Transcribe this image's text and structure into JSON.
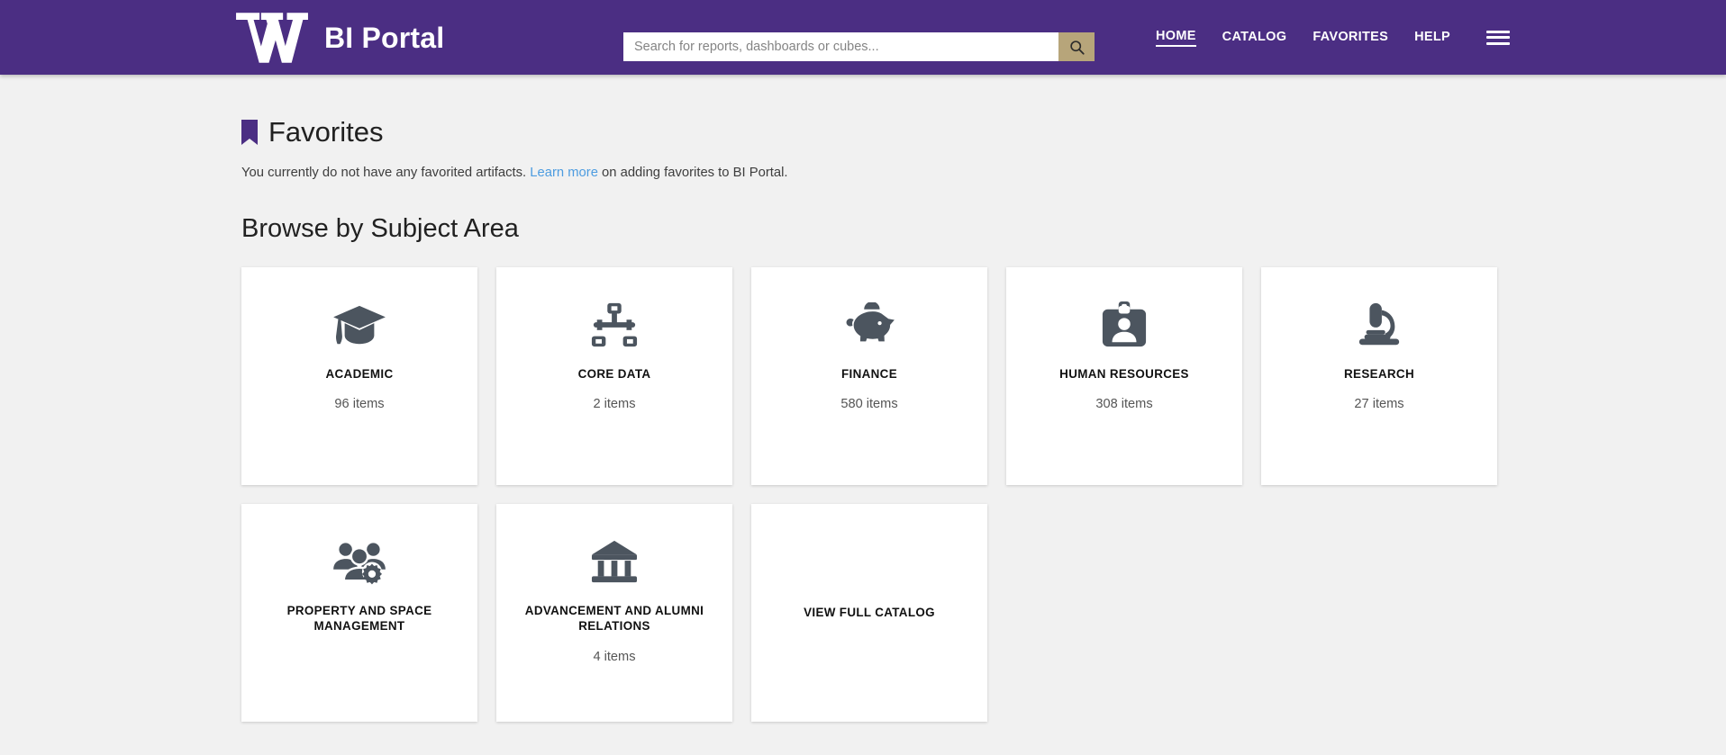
{
  "header": {
    "logo_icon": "uw-w-logo",
    "title": "BI Portal",
    "search": {
      "placeholder": "Search for reports, dashboards or cubes...",
      "value": "",
      "button_icon": "search-icon"
    },
    "nav": [
      {
        "label": "HOME",
        "active": true
      },
      {
        "label": "CATALOG",
        "active": false
      },
      {
        "label": "FAVORITES",
        "active": false
      },
      {
        "label": "HELP",
        "active": false
      }
    ],
    "menu_icon": "hamburger-menu-icon",
    "colors": {
      "background": "#4b2e83",
      "search_button": "#b7a57a"
    }
  },
  "favorites": {
    "icon": "bookmark-icon",
    "title": "Favorites",
    "message_before": "You currently do not have any favorited artifacts. ",
    "link_label": "Learn more",
    "message_after": " on adding favorites to BI Portal."
  },
  "browse": {
    "title": "Browse by Subject Area",
    "cards": [
      {
        "label": "ACADEMIC",
        "count": "96 items",
        "icon": "graduation-cap-icon"
      },
      {
        "label": "CORE DATA",
        "count": "2 items",
        "icon": "sitemap-icon"
      },
      {
        "label": "FINANCE",
        "count": "580 items",
        "icon": "piggy-bank-icon"
      },
      {
        "label": "HUMAN RESOURCES",
        "count": "308 items",
        "icon": "id-badge-icon"
      },
      {
        "label": "RESEARCH",
        "count": "27 items",
        "icon": "microscope-icon"
      },
      {
        "label": "PROPERTY AND SPACE MANAGEMENT",
        "count": "",
        "icon": "users-cog-icon"
      },
      {
        "label": "ADVANCEMENT AND ALUMNI RELATIONS",
        "count": "4 items",
        "icon": "university-icon"
      },
      {
        "label": "VIEW FULL CATALOG",
        "count": "",
        "icon": ""
      }
    ]
  },
  "colors": {
    "page_background": "#f1f1f1",
    "card_background": "#ffffff",
    "icon": "#4c555f",
    "link": "#4d9ce0",
    "accent_purple": "#4b2e83",
    "accent_gold": "#b7a57a"
  }
}
